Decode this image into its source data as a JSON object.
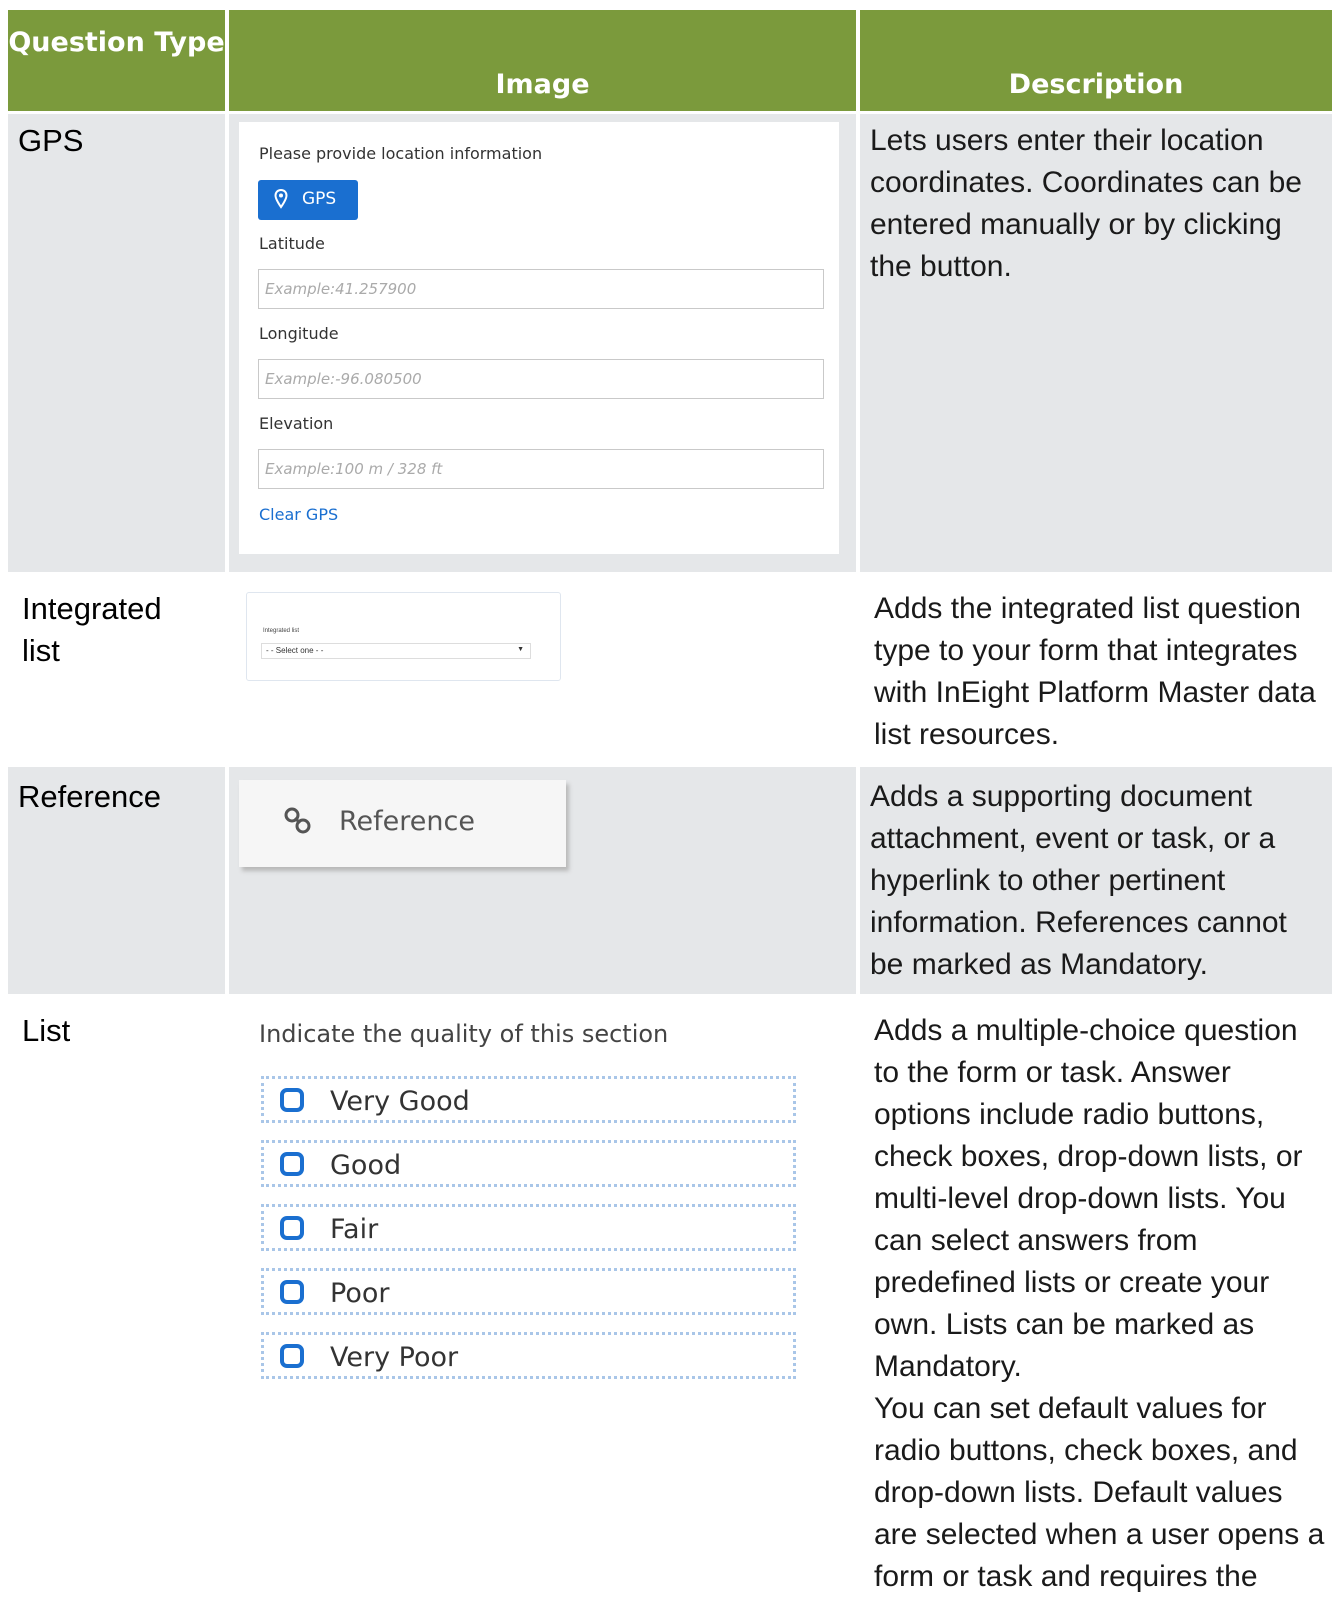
{
  "header": {
    "question_type": "Question Type",
    "image": "Image",
    "description": "Description"
  },
  "rows": {
    "gps": {
      "type": "GPS",
      "description": "Lets users enter their location coordinates. Coordinates can be entered manually or by clicking the button.",
      "image": {
        "prompt": "Please provide location information",
        "button_label": "GPS",
        "latitude_label": "Latitude",
        "latitude_placeholder": "Example:41.257900",
        "longitude_label": "Longitude",
        "longitude_placeholder": "Example:-96.080500",
        "elevation_label": "Elevation",
        "elevation_placeholder": "Example:100 m / 328 ft",
        "clear_label": "Clear GPS"
      }
    },
    "integrated_list": {
      "type": "Integrated list",
      "description": "Adds the integrated list question type to your form that integrates with InEight Platform Master data list resources.",
      "image": {
        "label": "Integrated list",
        "select_value": "- - Select one - -"
      }
    },
    "reference": {
      "type": "Reference",
      "description": "Adds a supporting document attachment, event or task, or a hyperlink to other pertinent information. References cannot be marked as Mandatory.",
      "image": {
        "button_label": "Reference"
      }
    },
    "list": {
      "type": "List",
      "description_1": "Adds a multiple-choice question to the form or task. Answer options include radio buttons, check boxes, drop-down lists, or multi-level drop-down lists. You can select answers from predefined lists or create your own. Lists can be marked as Mandatory.",
      "description_2": "You can set default values for radio buttons, check boxes, and drop-down lists. Default values are selected when a user opens a form or task and requires the",
      "image": {
        "question": "Indicate the quality of this section",
        "options": [
          "Very Good",
          "Good",
          "Fair",
          "Poor",
          "Very Poor"
        ]
      }
    }
  },
  "colors": {
    "header_bg": "#7b9a3c",
    "row_bg": "#e5e7e9",
    "accent": "#1a6fd0"
  }
}
